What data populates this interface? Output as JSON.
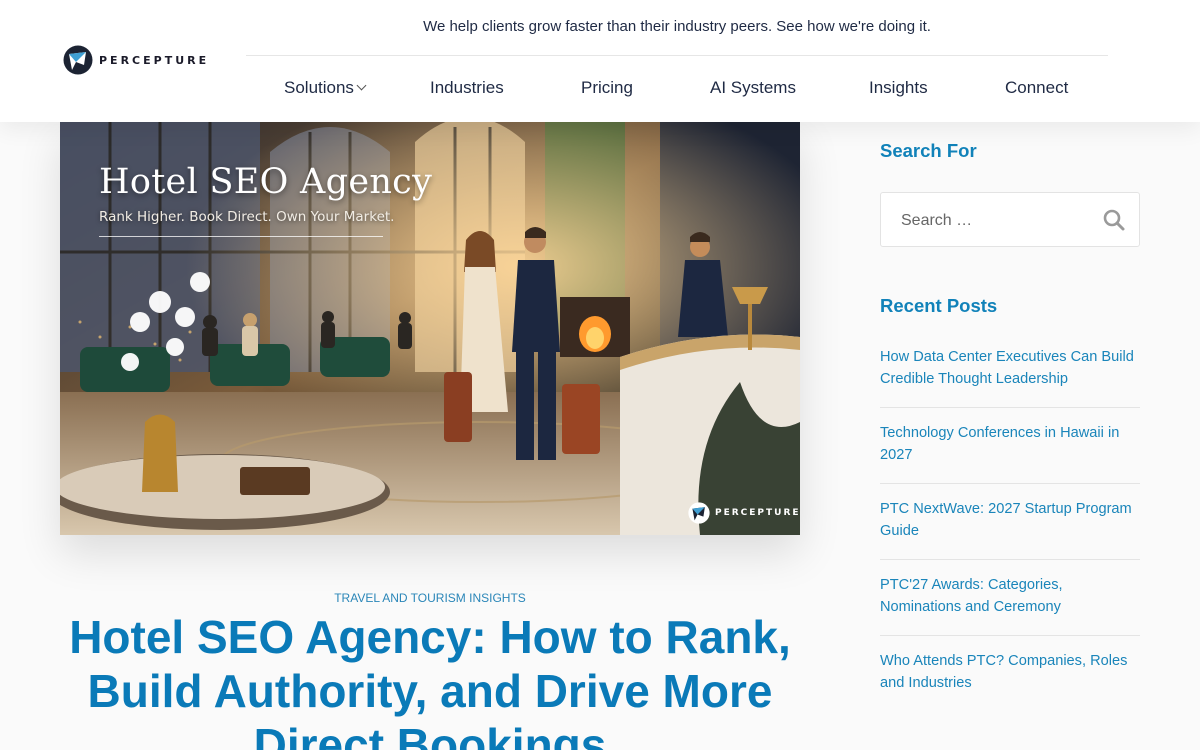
{
  "brand": {
    "name": "PERCEPTURE"
  },
  "header": {
    "tagline": "We help clients grow faster than their industry peers. See how we're doing it."
  },
  "nav": {
    "items": [
      {
        "label": "Solutions"
      },
      {
        "label": "Industries"
      },
      {
        "label": "Pricing"
      },
      {
        "label": "AI Systems"
      },
      {
        "label": "Insights"
      },
      {
        "label": "Connect"
      }
    ]
  },
  "hero": {
    "title": "Hotel SEO Agency",
    "subtitle": "Rank Higher. Book Direct. Own Your Market.",
    "watermark": "PERCEPTURE"
  },
  "article": {
    "category": "Travel and Tourism Insights",
    "title": "Hotel SEO Agency: How to Rank, Build Authority, and Drive More Direct Bookings"
  },
  "sidebar": {
    "search": {
      "title": "Search For",
      "placeholder": "Search …",
      "icon": "search-icon"
    },
    "recent": {
      "title": "Recent Posts",
      "posts": [
        {
          "title": "How Data Center Executives Can Build Credible Thought Leadership"
        },
        {
          "title": "Technology Conferences in Hawaii in 2027"
        },
        {
          "title": "PTC NextWave: 2027 Startup Program Guide"
        },
        {
          "title": "PTC'27 Awards: Categories, Nominations and Ceremony"
        },
        {
          "title": "Who Attends PTC? Companies, Roles and Industries"
        }
      ]
    }
  },
  "colors": {
    "accent": "#0a7ab8",
    "link": "#1a85ba",
    "nav_text": "#1f2a44"
  }
}
